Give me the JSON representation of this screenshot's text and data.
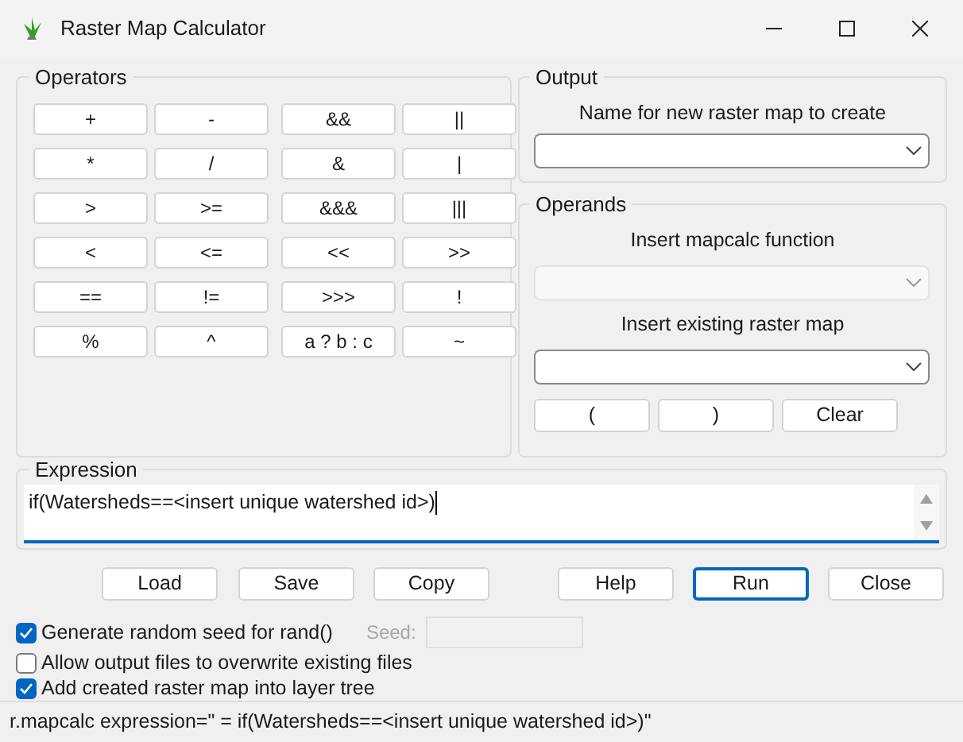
{
  "window": {
    "title": "Raster Map Calculator"
  },
  "operators": {
    "title": "Operators",
    "buttons": [
      "+",
      "-",
      "&&",
      "||",
      "*",
      "/",
      "&",
      "|",
      ">",
      ">=",
      "&&&",
      "|||",
      "<",
      "<=",
      "<<",
      ">>",
      "==",
      "!=",
      ">>>",
      "!",
      "%",
      "^",
      "a ? b : c",
      "~"
    ]
  },
  "output": {
    "title": "Output",
    "label": "Name for new raster map to create",
    "combo": {
      "disabled": false
    }
  },
  "operands": {
    "title": "Operands",
    "function_label": "Insert mapcalc function",
    "function_combo": {
      "disabled": true
    },
    "map_label": "Insert existing raster map",
    "map_combo": {
      "disabled": false
    },
    "buttons": [
      "(",
      ")",
      "Clear"
    ]
  },
  "expression": {
    "title": "Expression",
    "value": "if(Watersheds==<insert unique watershed id>)"
  },
  "buttons": [
    {
      "label": "Load",
      "default": false
    },
    {
      "label": "Save",
      "default": false
    },
    {
      "label": "Copy",
      "default": false
    },
    {
      "label": "Help",
      "default": false
    },
    {
      "label": "Run",
      "default": true
    },
    {
      "label": "Close",
      "default": false
    }
  ],
  "options": [
    {
      "label": "Generate random seed for rand()",
      "checked": true
    },
    {
      "label": "Allow output files to overwrite existing files",
      "checked": false
    },
    {
      "label": "Add created raster map into layer tree",
      "checked": true
    }
  ],
  "seed": {
    "label": "Seed:",
    "disabled": true
  },
  "status_bar": {
    "text": "r.mapcalc expression=\" = if(Watersheds==<insert unique watershed id>)\""
  }
}
